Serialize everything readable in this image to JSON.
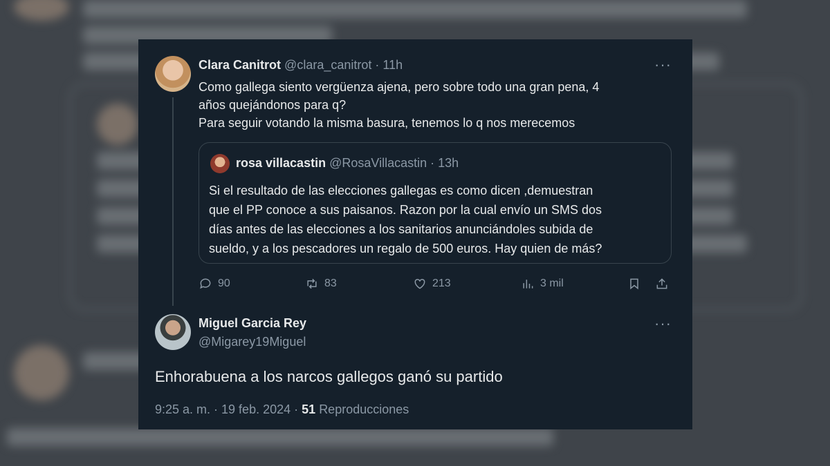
{
  "background": {
    "text_lines": [],
    "colors": {
      "backdrop": "#3f444a",
      "card": "#15202b"
    }
  },
  "original_tweet": {
    "author_name": "Clara Canitrot",
    "handle": "@clara_canitrot",
    "separator": "·",
    "time": "11h",
    "more_label": "···",
    "text_lines": [
      "Como gallega siento vergüenza ajena, pero sobre todo una gran pena, 4",
      "años quejándonos para q?",
      "Para seguir votando la misma basura, tenemos lo q nos merecemos"
    ]
  },
  "quoted_tweet": {
    "author_name": "rosa villacastin",
    "handle": "@RosaVillacastin",
    "separator": "·",
    "time": "13h",
    "text_lines": [
      "Si el resultado de las elecciones gallegas es como dicen ,demuestran",
      "que el PP conoce a sus paisanos. Razon por la cual envío un SMS dos",
      "días antes de las elecciones a los sanitarios anunciándoles subida de",
      "sueldo, y a los pescadores un regalo de 500 euros. Hay quien de más?"
    ]
  },
  "actions": {
    "replies": "90",
    "retweets": "83",
    "likes": "213",
    "views": "3 mil"
  },
  "reply_tweet": {
    "author_name": "Miguel Garcia Rey",
    "handle": "@Migarey19Miguel",
    "more_label": "···",
    "text": "Enhorabuena a los narcos gallegos ganó su partido",
    "timestamp": "9:25 a. m. · 19 feb. 2024 ·",
    "views_count": "51",
    "views_label": "Reproducciones"
  },
  "icons": [
    "reply-icon",
    "retweet-icon",
    "like-icon",
    "views-icon",
    "bookmark-icon",
    "share-icon",
    "more-icon"
  ]
}
